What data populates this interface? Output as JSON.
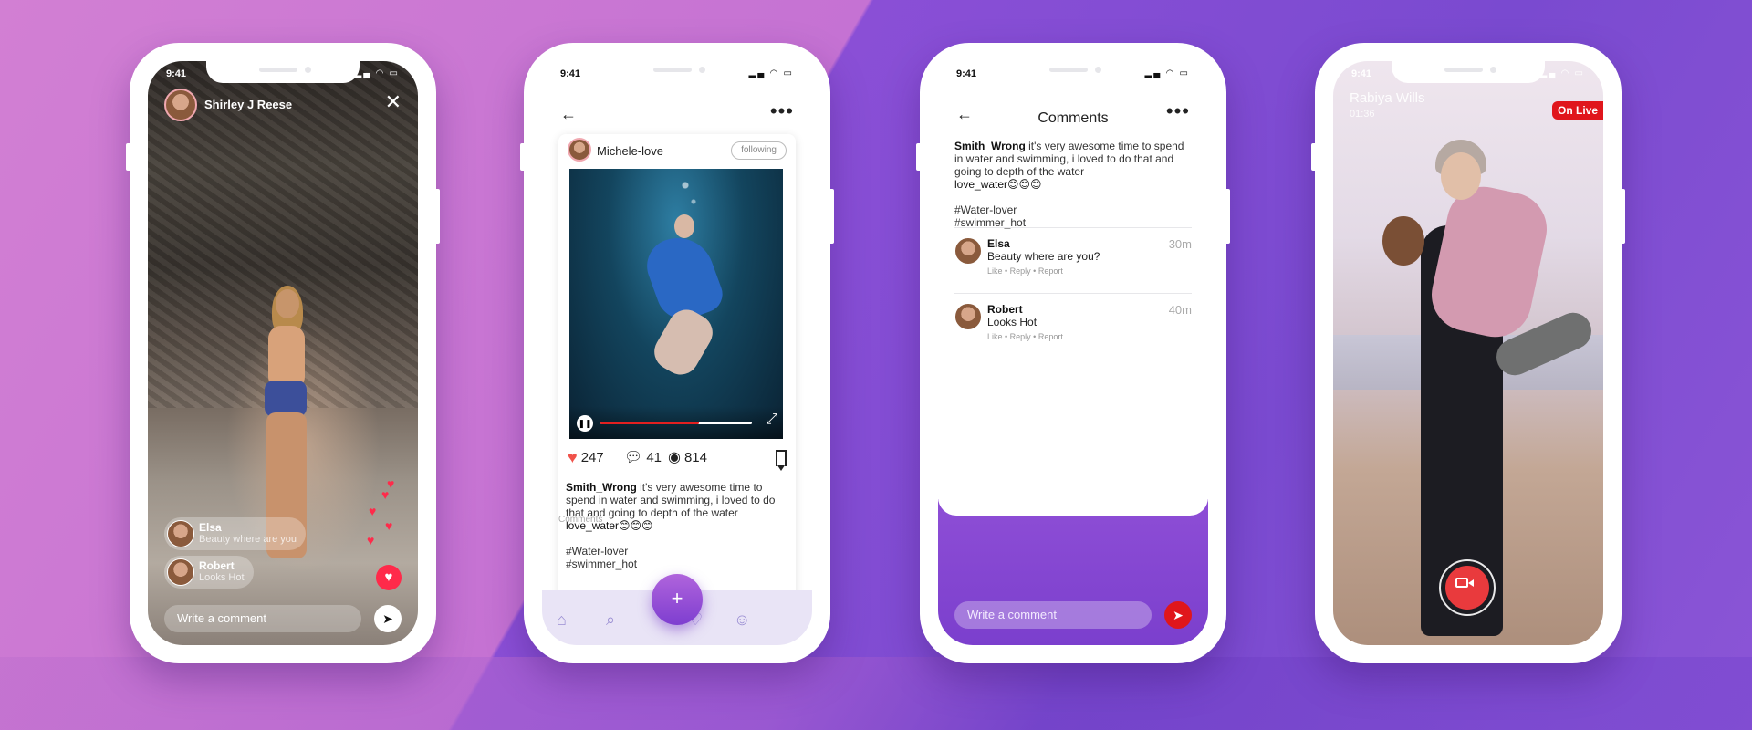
{
  "screen1": {
    "time": "9:41",
    "user_name": "Shirley J Reese",
    "close_glyph": "✕",
    "comments": [
      {
        "name": "Elsa",
        "text": "Beauty where are you"
      },
      {
        "name": "Robert",
        "text": "Looks Hot"
      }
    ],
    "comment_placeholder": "Write a comment"
  },
  "screen2": {
    "time": "9:41",
    "author": "Michele-love",
    "follow_label": "following",
    "video_progress": 0.65,
    "likes": "247",
    "comments_count": "41",
    "views": "814",
    "caption_user": "Smith_Wrong",
    "caption_text": " it's very awesome time to spend in water and swimming, i loved to do that and going to depth of the water",
    "caption_tail": "love_water😊😊😊",
    "tag1": "#Water-lover",
    "tag2": "#swimmer_hot",
    "comments_label": "Comments",
    "fab_glyph": "+"
  },
  "screen3": {
    "time": "9:41",
    "title": "Comments",
    "caption_user": "Smith_Wrong",
    "caption_text": " it's very awesome time to spend in water and swimming, i loved to do that and going to depth of the water",
    "caption_tail": "love_water😊😊😊",
    "tag1": "#Water-lover",
    "tag2": "#swimmer_hot",
    "comments": [
      {
        "name": "Elsa",
        "text": "Beauty where are you?",
        "time": "30m",
        "actions": "Like • Reply • Report"
      },
      {
        "name": "Robert",
        "text": "Looks Hot",
        "time": "40m",
        "actions": "Like • Reply • Report"
      }
    ],
    "comment_placeholder": "Write a comment"
  },
  "screen4": {
    "time": "9:41",
    "streamer": "Rabiya Wills",
    "duration": "01:36",
    "live_badge": "On Live"
  },
  "colors": {
    "accent_red": "#e0161c",
    "purple": "#8e4ed6"
  }
}
